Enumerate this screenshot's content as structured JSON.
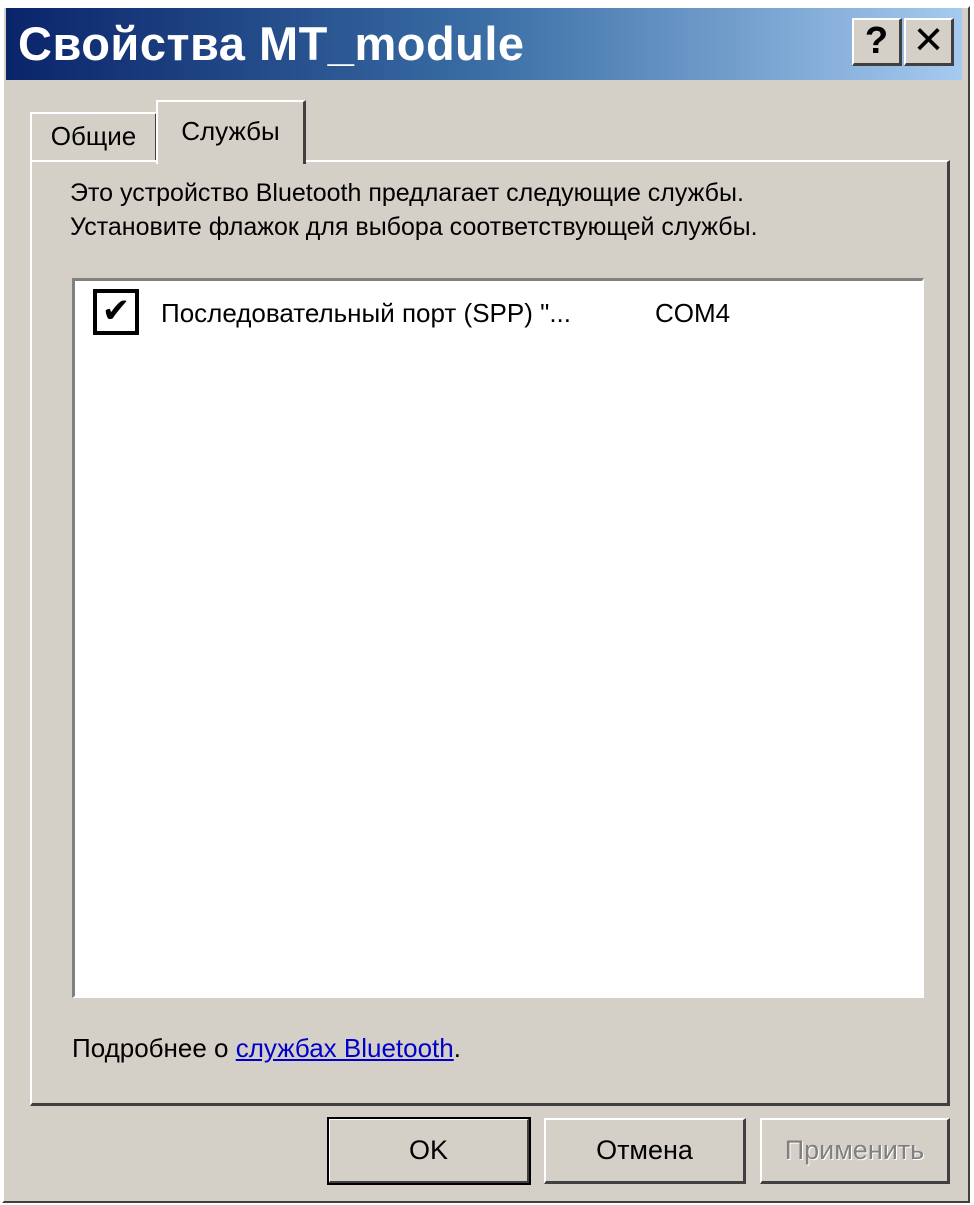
{
  "window": {
    "title": "Свойства MT_module",
    "help_label": "?",
    "close_label": "✕"
  },
  "tabs": [
    {
      "label": "Общие",
      "active": false
    },
    {
      "label": "Службы",
      "active": true
    }
  ],
  "panel": {
    "description_line1": "Это устройство Bluetooth предлагает следующие службы.",
    "description_line2": "Установите флажок для выбора соответствующей службы."
  },
  "services": [
    {
      "name": "Последовательный порт (SPP) \"...",
      "port": "COM4",
      "checked": true,
      "check_glyph": "✔"
    }
  ],
  "more_info": {
    "prefix": "Подробнее о ",
    "link_text": "службах Bluetooth",
    "suffix": "."
  },
  "buttons": {
    "ok": "OK",
    "cancel": "Отмена",
    "apply": "Применить"
  },
  "colors": {
    "titlebar_start": "#0a246a",
    "titlebar_end": "#a6caf0",
    "dialog_face": "#d4d0c8",
    "link": "#0000cc"
  }
}
